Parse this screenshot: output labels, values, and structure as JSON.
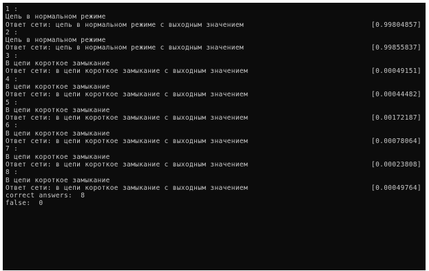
{
  "console": {
    "lines": [
      {
        "text": "1 :",
        "value": ""
      },
      {
        "text": "Цепь в нормальном режиме",
        "value": ""
      },
      {
        "text": "Ответ сети: цепь в нормальном режиме с выходным значением",
        "value": "[0.99804857]"
      },
      {
        "text": "2 :",
        "value": ""
      },
      {
        "text": "Цепь в нормальном режиме",
        "value": ""
      },
      {
        "text": "Ответ сети: цепь в нормальном режиме с выходным значением",
        "value": "[0.99855837]"
      },
      {
        "text": "3 :",
        "value": ""
      },
      {
        "text": "В цепи короткое замыкание",
        "value": ""
      },
      {
        "text": "Ответ сети: в цепи короткое замыкание с выходным значением",
        "value": "[0.00049151]"
      },
      {
        "text": "4 :",
        "value": ""
      },
      {
        "text": "В цепи короткое замыкание",
        "value": ""
      },
      {
        "text": "Ответ сети: в цепи короткое замыкание с выходным значением",
        "value": "[0.00044482]"
      },
      {
        "text": "5 :",
        "value": ""
      },
      {
        "text": "В цепи короткое замыкание",
        "value": ""
      },
      {
        "text": "Ответ сети: в цепи короткое замыкание с выходным значением",
        "value": "[0.00172187]"
      },
      {
        "text": "6 :",
        "value": ""
      },
      {
        "text": "В цепи короткое замыкание",
        "value": ""
      },
      {
        "text": "Ответ сети: в цепи короткое замыкание с выходным значением",
        "value": "[0.00078064]"
      },
      {
        "text": "7 :",
        "value": ""
      },
      {
        "text": "В цепи короткое замыкание",
        "value": ""
      },
      {
        "text": "Ответ сети: в цепи короткое замыкание с выходным значением",
        "value": "[0.00023808]"
      },
      {
        "text": "8 :",
        "value": ""
      },
      {
        "text": "В цепи короткое замыкание",
        "value": ""
      },
      {
        "text": "Ответ сети: в цепи короткое замыкание с выходным значением",
        "value": "[0.00049764]"
      },
      {
        "text": "correct answers:  8",
        "value": ""
      },
      {
        "text": "false:  0",
        "value": ""
      }
    ]
  },
  "colors": {
    "background": "#0c0c0c",
    "text": "#c8c8c8"
  }
}
